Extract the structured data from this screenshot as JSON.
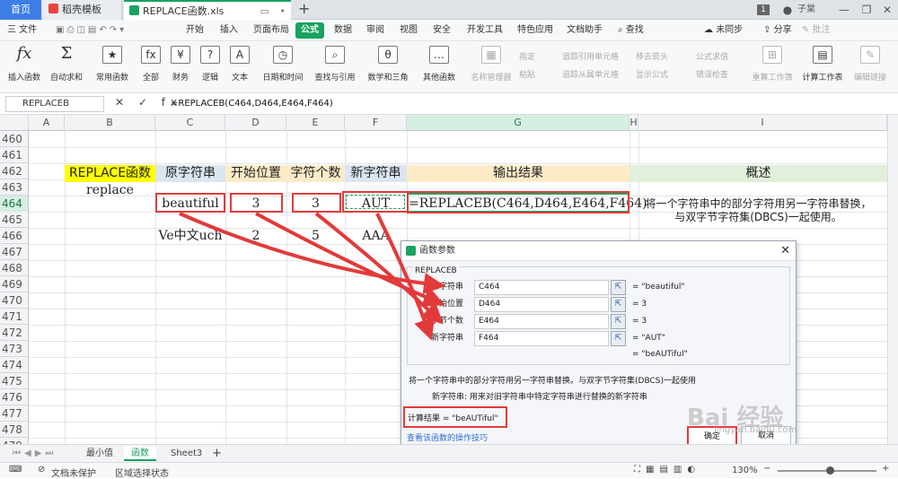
{
  "tabs": {
    "home": "首页",
    "doc_template": "稻壳模板",
    "file": "REPLACE函数.xls",
    "new_tab_symbol": "+",
    "page_indicator": "1",
    "user": "子棠"
  },
  "menu": {
    "file": "三 文件",
    "items": [
      "开始",
      "插入",
      "页面布局",
      "公式",
      "数据",
      "审阅",
      "视图",
      "安全",
      "开发工具",
      "特色应用",
      "文档助手"
    ],
    "active": "公式",
    "search": "查找",
    "sync": "未同步",
    "share": "分享",
    "comment": "批注"
  },
  "ribbon": {
    "buttons": [
      {
        "icon": "fx",
        "label": "插入函数"
      },
      {
        "icon": "Σ",
        "label": "自动求和"
      },
      {
        "icon": "★",
        "label": "常用函数"
      },
      {
        "icon": "fx",
        "label": "全部"
      },
      {
        "icon": "¥",
        "label": "财务"
      },
      {
        "icon": "?",
        "label": "逻辑"
      },
      {
        "icon": "A",
        "label": "文本"
      },
      {
        "icon": "◷",
        "label": "日期和时间"
      },
      {
        "icon": "⌕",
        "label": "查找与引用"
      },
      {
        "icon": "θ",
        "label": "数学和三角"
      },
      {
        "icon": "…",
        "label": "其他函数"
      }
    ],
    "dim_buttons": [
      {
        "icon": "▦",
        "label": "名称管理器"
      },
      {
        "icon": "⊞",
        "label": "重算工作簿"
      },
      {
        "icon": "▤",
        "label": "计算工作表"
      },
      {
        "icon": "✎",
        "label": "编辑链接"
      }
    ],
    "small": [
      "指定",
      "粘贴",
      "追踪引用单元格",
      "追踪从属单元格",
      "移去箭头",
      "显示公式",
      "公式求值",
      "错误检查"
    ]
  },
  "formula_bar": {
    "name_box": "REPLACEB",
    "symbols": "✕ ✓ fx",
    "formula": "=REPLACEB(C464,D464,E464,F464)"
  },
  "sheet": {
    "columns": [
      "A",
      "B",
      "C",
      "D",
      "E",
      "F",
      "G",
      "H",
      "I"
    ],
    "rows": [
      "460",
      "461",
      "462",
      "463",
      "464",
      "465",
      "466",
      "467",
      "468",
      "469",
      "470",
      "471",
      "472",
      "473",
      "474",
      "475",
      "476",
      "477",
      "478",
      "479"
    ],
    "selected_row": "464",
    "selected_col": "G",
    "header_row": {
      "b": "REPLACE函数",
      "c": "原字符串",
      "d": "开始位置",
      "e": "字符个数",
      "f": "新字符串",
      "g": "输出结果",
      "i": "概述"
    },
    "row463_b": "replace",
    "row464": {
      "c": "beautiful",
      "d": "3",
      "e": "3",
      "f": "AUT",
      "g": "=REPLACEB(C464,D464,E464,F464)",
      "i": "将一个字符串中的部分字符用另一字符串替换，"
    },
    "row465_i": "与双字节字符集(DBCS)一起使用。",
    "row466": {
      "c": "Ve中文uch",
      "d": "2",
      "e": "5",
      "f": "AAA"
    },
    "colors": {
      "yellow": "#ffff00",
      "blue": "#dce6f1",
      "orange": "#fdebc8",
      "green": "#e2efda",
      "red": "#e23a3a",
      "accent": "#1aa260"
    }
  },
  "dialog": {
    "title": "函数参数",
    "close": "✕",
    "function_name": "REPLACEB",
    "args": [
      {
        "label": "原字符串",
        "value": "C464",
        "result": "= \"beautiful\""
      },
      {
        "label": "开始位置",
        "value": "D464",
        "result": "= 3"
      },
      {
        "label": "字节个数",
        "value": "E464",
        "result": "= 3"
      },
      {
        "label": "新字符串",
        "value": "F464",
        "result": "= \"AUT\""
      }
    ],
    "ref_button": "⇱",
    "result_line": "= \"beAUTiful\"",
    "description": "将一个字符串中的部分字符用另一字符串替换。与双字节字符集(DBCS)一起使用",
    "arg_help": "新字符串:   用来对旧字符串中特定字符串进行替换的新字符串",
    "calc_result": "计算结果 = \"beAUTiful\"",
    "help_link": "查看该函数的操作技巧",
    "ok": "确定",
    "cancel": "取消"
  },
  "sheet_tabs": {
    "items": [
      "最小值",
      "函数",
      "Sheet3"
    ],
    "active": "函数",
    "add": "+"
  },
  "status": {
    "doc_protect": "文档未保护",
    "area_state": "区域选择状态",
    "zoom": "130%"
  },
  "watermark": {
    "main": "Bai 经验",
    "sub": "jingyan.baidu.com"
  }
}
